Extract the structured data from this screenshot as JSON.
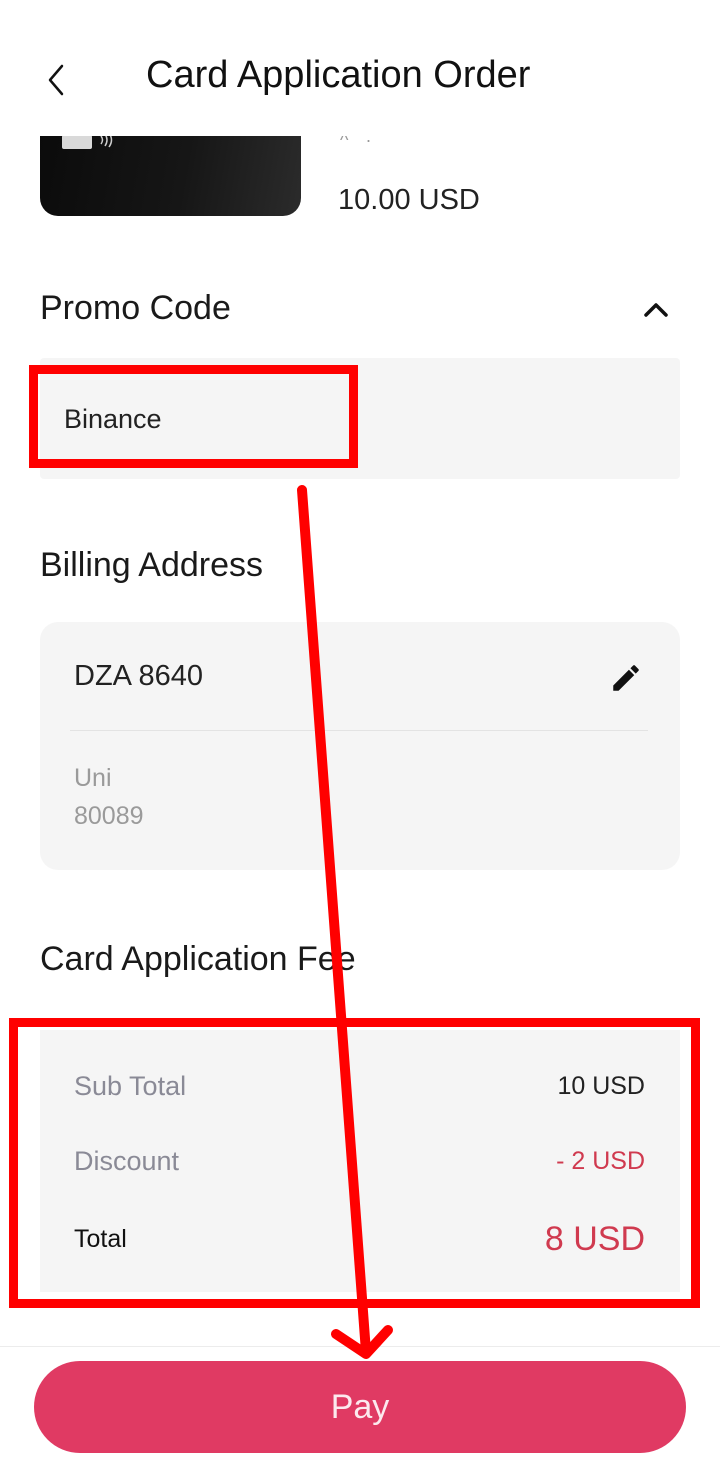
{
  "header": {
    "title": "Card Application Order",
    "back_icon": "chevron-left-icon"
  },
  "card": {
    "partial_text": "^ ·",
    "price": "10.00 USD"
  },
  "promo": {
    "title": "Promo Code",
    "toggle_icon": "chevron-up-icon",
    "value": "Binance"
  },
  "billing": {
    "title": "Billing Address",
    "line1": "DZA 8640",
    "line2": "Uni",
    "line3": "80089",
    "edit_icon": "pencil-icon"
  },
  "fee": {
    "title": "Card Application Fee",
    "sub_total_label": "Sub Total",
    "sub_total_value": "10 USD",
    "discount_label": "Discount",
    "discount_value": "- 2 USD",
    "total_label": "Total",
    "total_value": "8 USD"
  },
  "actions": {
    "pay_label": "Pay"
  },
  "colors": {
    "accent": "#e03a63",
    "discount": "#d03a4f",
    "annotation": "#ff0000"
  }
}
